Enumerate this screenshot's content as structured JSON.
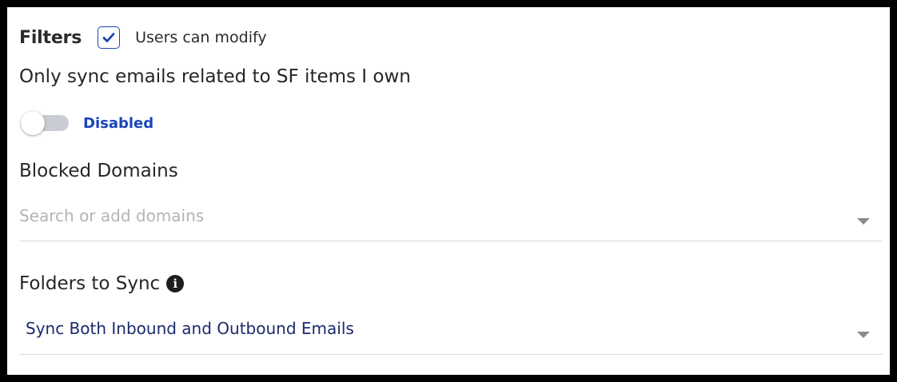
{
  "filters": {
    "title": "Filters",
    "users_can_modify": {
      "label": "Users can modify",
      "checked": true
    }
  },
  "sync_owned": {
    "label": "Only sync emails related to SF items I own",
    "toggle_enabled": false,
    "status_text": "Disabled"
  },
  "blocked_domains": {
    "label": "Blocked Domains",
    "placeholder": "Search or add domains",
    "value": ""
  },
  "folders_to_sync": {
    "label": "Folders to Sync",
    "info_icon": "info-circle-icon",
    "selected": "Sync Both Inbound and Outbound Emails"
  },
  "colors": {
    "accent": "#1a45b8",
    "select_text": "#1a2a6c",
    "toggle_off_track": "#c9cdd3",
    "frame": "#000000"
  }
}
